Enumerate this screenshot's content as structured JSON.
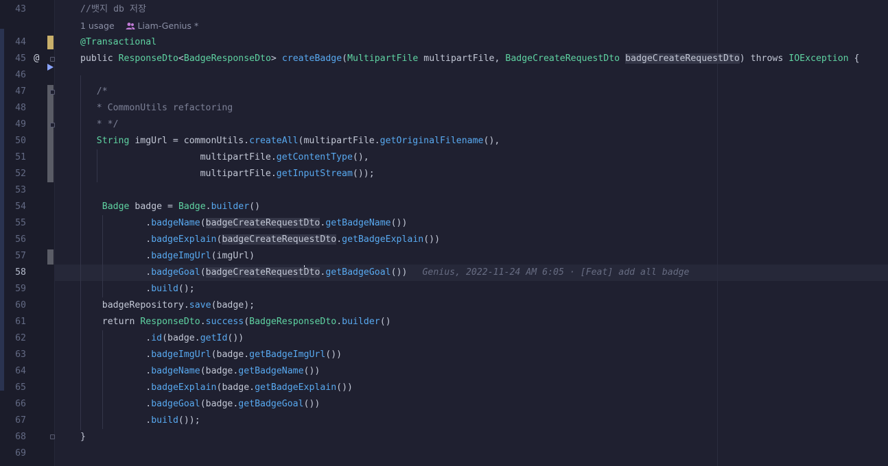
{
  "lines": [
    {
      "n": "43",
      "parts": [
        {
          "c": "cm",
          "t": "//뱃지 db 저장"
        }
      ]
    },
    {
      "n": "44",
      "parts": [
        {
          "c": "an",
          "t": "@Transactional"
        }
      ]
    },
    {
      "n": "45",
      "parts": [
        {
          "c": "kw",
          "t": "public "
        },
        {
          "c": "ty",
          "t": "ResponseDto"
        },
        {
          "c": "kw",
          "t": "<"
        },
        {
          "c": "ty",
          "t": "BadgeResponseDto"
        },
        {
          "c": "kw",
          "t": "> "
        },
        {
          "c": "fn",
          "t": "createBadge"
        },
        {
          "c": "kw",
          "t": "("
        },
        {
          "c": "ty",
          "t": "MultipartFile"
        },
        {
          "c": "kw",
          "t": " multipartFile, "
        },
        {
          "c": "ty",
          "t": "BadgeCreateRequestDto"
        },
        {
          "c": "kw",
          "t": " "
        },
        {
          "c": "hl",
          "t": "badgeCreateRequestDto"
        },
        {
          "c": "kw",
          "t": ") throws "
        },
        {
          "c": "ty",
          "t": "IOException"
        },
        {
          "c": "kw",
          "t": " {"
        }
      ]
    },
    {
      "n": "46",
      "parts": []
    },
    {
      "n": "47",
      "parts": [
        {
          "c": "cm",
          "t": "    /*"
        }
      ]
    },
    {
      "n": "48",
      "parts": [
        {
          "c": "cm",
          "t": "    * CommonUtils refactoring"
        }
      ]
    },
    {
      "n": "49",
      "parts": [
        {
          "c": "cm",
          "t": "    * */"
        }
      ]
    },
    {
      "n": "50",
      "parts": [
        {
          "c": "kw",
          "t": "    "
        },
        {
          "c": "ty",
          "t": "String"
        },
        {
          "c": "kw",
          "t": " imgUrl = commonUtils."
        },
        {
          "c": "fn",
          "t": "createAll"
        },
        {
          "c": "kw",
          "t": "(multipartFile."
        },
        {
          "c": "fn",
          "t": "getOriginalFilename"
        },
        {
          "c": "kw",
          "t": "(),"
        }
      ]
    },
    {
      "n": "51",
      "parts": [
        {
          "c": "kw",
          "t": "                       multipartFile."
        },
        {
          "c": "fn",
          "t": "getContentType"
        },
        {
          "c": "kw",
          "t": "(),"
        }
      ]
    },
    {
      "n": "52",
      "parts": [
        {
          "c": "kw",
          "t": "                       multipartFile."
        },
        {
          "c": "fn",
          "t": "getInputStream"
        },
        {
          "c": "kw",
          "t": "());"
        }
      ]
    },
    {
      "n": "53",
      "parts": []
    },
    {
      "n": "54",
      "parts": [
        {
          "c": "kw",
          "t": "    "
        },
        {
          "c": "ty",
          "t": "Badge"
        },
        {
          "c": "kw",
          "t": " badge = "
        },
        {
          "c": "ty",
          "t": "Badge"
        },
        {
          "c": "kw",
          "t": "."
        },
        {
          "c": "fn",
          "t": "builder"
        },
        {
          "c": "kw",
          "t": "()"
        }
      ]
    },
    {
      "n": "55",
      "parts": [
        {
          "c": "kw",
          "t": "            ."
        },
        {
          "c": "fn",
          "t": "badgeName"
        },
        {
          "c": "kw",
          "t": "("
        },
        {
          "c": "hl",
          "t": "badgeCreateRequestDto"
        },
        {
          "c": "kw",
          "t": "."
        },
        {
          "c": "fn",
          "t": "getBadgeName"
        },
        {
          "c": "kw",
          "t": "())"
        }
      ]
    },
    {
      "n": "56",
      "parts": [
        {
          "c": "kw",
          "t": "            ."
        },
        {
          "c": "fn",
          "t": "badgeExplain"
        },
        {
          "c": "kw",
          "t": "("
        },
        {
          "c": "hl",
          "t": "badgeCreateRequestDto"
        },
        {
          "c": "kw",
          "t": "."
        },
        {
          "c": "fn",
          "t": "getBadgeExplain"
        },
        {
          "c": "kw",
          "t": "())"
        }
      ]
    },
    {
      "n": "57",
      "parts": [
        {
          "c": "kw",
          "t": "            ."
        },
        {
          "c": "fn",
          "t": "badgeImgUrl"
        },
        {
          "c": "kw",
          "t": "(imgUrl)"
        }
      ]
    },
    {
      "n": "58",
      "parts": [
        {
          "c": "kw",
          "t": "            ."
        },
        {
          "c": "fn",
          "t": "badgeGoal"
        },
        {
          "c": "kw",
          "t": "("
        },
        {
          "c": "hl",
          "t": "badgeCreateRequest"
        },
        {
          "c": "caret",
          "t": ""
        },
        {
          "c": "hl",
          "t": "Dto"
        },
        {
          "c": "kw",
          "t": "."
        },
        {
          "c": "fn",
          "t": "getBadgeGoal"
        },
        {
          "c": "kw",
          "t": "())"
        },
        {
          "c": "blame",
          "t": "Genius, 2022-11-24 AM 6:05 · [Feat] add all badge"
        }
      ]
    },
    {
      "n": "59",
      "parts": [
        {
          "c": "kw",
          "t": "            ."
        },
        {
          "c": "fn",
          "t": "build"
        },
        {
          "c": "kw",
          "t": "();"
        }
      ]
    },
    {
      "n": "60",
      "parts": [
        {
          "c": "kw",
          "t": "    badgeRepository."
        },
        {
          "c": "fn",
          "t": "save"
        },
        {
          "c": "kw",
          "t": "(badge);"
        }
      ]
    },
    {
      "n": "61",
      "parts": [
        {
          "c": "kw",
          "t": "    return "
        },
        {
          "c": "ty",
          "t": "ResponseDto"
        },
        {
          "c": "kw",
          "t": "."
        },
        {
          "c": "fn",
          "t": "success"
        },
        {
          "c": "kw",
          "t": "("
        },
        {
          "c": "ty",
          "t": "BadgeResponseDto"
        },
        {
          "c": "kw",
          "t": "."
        },
        {
          "c": "fn",
          "t": "builder"
        },
        {
          "c": "kw",
          "t": "()"
        }
      ]
    },
    {
      "n": "62",
      "parts": [
        {
          "c": "kw",
          "t": "            ."
        },
        {
          "c": "fn",
          "t": "id"
        },
        {
          "c": "kw",
          "t": "(badge."
        },
        {
          "c": "fn",
          "t": "getId"
        },
        {
          "c": "kw",
          "t": "())"
        }
      ]
    },
    {
      "n": "63",
      "parts": [
        {
          "c": "kw",
          "t": "            ."
        },
        {
          "c": "fn",
          "t": "badgeImgUrl"
        },
        {
          "c": "kw",
          "t": "(badge."
        },
        {
          "c": "fn",
          "t": "getBadgeImgUrl"
        },
        {
          "c": "kw",
          "t": "())"
        }
      ]
    },
    {
      "n": "64",
      "parts": [
        {
          "c": "kw",
          "t": "            ."
        },
        {
          "c": "fn",
          "t": "badgeName"
        },
        {
          "c": "kw",
          "t": "(badge."
        },
        {
          "c": "fn",
          "t": "getBadgeName"
        },
        {
          "c": "kw",
          "t": "())"
        }
      ]
    },
    {
      "n": "65",
      "parts": [
        {
          "c": "kw",
          "t": "            ."
        },
        {
          "c": "fn",
          "t": "badgeExplain"
        },
        {
          "c": "kw",
          "t": "(badge."
        },
        {
          "c": "fn",
          "t": "getBadgeExplain"
        },
        {
          "c": "kw",
          "t": "())"
        }
      ]
    },
    {
      "n": "66",
      "parts": [
        {
          "c": "kw",
          "t": "            ."
        },
        {
          "c": "fn",
          "t": "badgeGoal"
        },
        {
          "c": "kw",
          "t": "(badge."
        },
        {
          "c": "fn",
          "t": "getBadgeGoal"
        },
        {
          "c": "kw",
          "t": "())"
        }
      ]
    },
    {
      "n": "67",
      "parts": [
        {
          "c": "kw",
          "t": "            ."
        },
        {
          "c": "fn",
          "t": "build"
        },
        {
          "c": "kw",
          "t": "());"
        }
      ]
    },
    {
      "n": "68",
      "parts": [
        {
          "c": "kw",
          "t": "}"
        }
      ]
    },
    {
      "n": "69",
      "parts": []
    }
  ],
  "usage_hint": {
    "count": "1 usage",
    "author": "Liam-Genius *"
  },
  "gutter_icons": {
    "override": "@",
    "run": "run-gutter-icon"
  },
  "colors": {
    "keyword": "#c3c8d6",
    "type": "#5fd3a2",
    "method": "#58a9f0",
    "comment": "#7c8096",
    "annotation": "#5fd3a2"
  }
}
